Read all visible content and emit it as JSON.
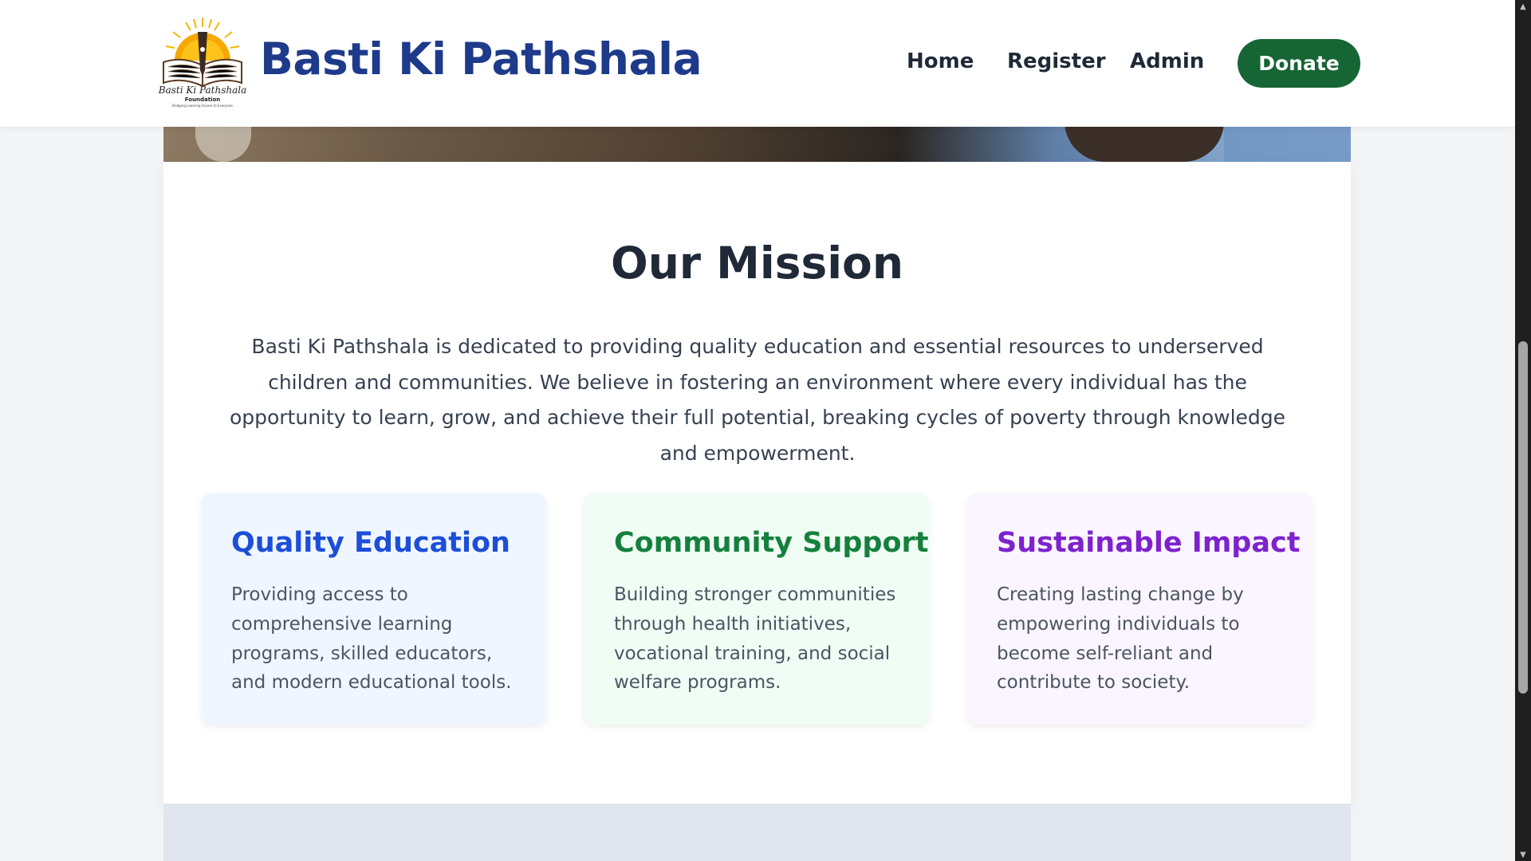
{
  "header": {
    "brand": "Basti Ki Pathshala",
    "logo": {
      "script_text": "Basti Ki Pathshala",
      "sub_text": "Foundation",
      "tagline": "Bridging Learning Access to Everyone"
    },
    "nav": {
      "home": "Home",
      "register": "Register",
      "admin": "Admin"
    },
    "donate_label": "Donate"
  },
  "mission": {
    "title": "Our Mission",
    "description": "Basti Ki Pathshala is dedicated to providing quality education and essential resources to underserved children and communities. We believe in fostering an environment where every individual has the opportunity to learn, grow, and achieve their full potential, breaking cycles of poverty through knowledge and empowerment.",
    "cards": [
      {
        "title": "Quality Education",
        "text": "Providing access to comprehensive learning programs, skilled educators, and modern educational tools.",
        "title_color": "#1d4ed8"
      },
      {
        "title": "Community Support",
        "text": "Building stronger communities through health initiatives, vocational training, and social welfare programs.",
        "title_color": "#15803d"
      },
      {
        "title": "Sustainable Impact",
        "text": "Creating lasting change by empowering individuals to become self-reliant and contribute to society.",
        "title_color": "#7e22ce"
      }
    ]
  },
  "colors": {
    "brand": "#1e3a8a",
    "donate_bg": "#166534",
    "page_bg": "#f3f4f6"
  },
  "icons": {
    "scroll_up": "scroll-up-arrow-icon",
    "scroll_down": "scroll-down-arrow-icon"
  }
}
